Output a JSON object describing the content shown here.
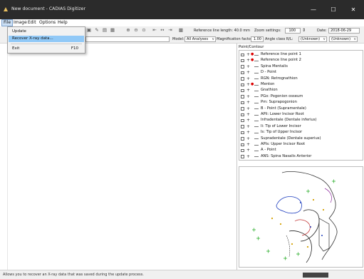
{
  "window": {
    "title": "New document - CADIAS Digitizer",
    "minimize": "—",
    "maximize": "☐",
    "close": "✕"
  },
  "menubar": [
    "File",
    "Image",
    "Edit",
    "Options",
    "Help"
  ],
  "file_menu": {
    "items": [
      {
        "label": "Update",
        "shortcut": ""
      },
      {
        "label": "Recover X-ray data...",
        "shortcut": ""
      },
      {
        "label": "Exit",
        "shortcut": "F10"
      }
    ]
  },
  "toolbar": {
    "ref_length_label": "Reference line length: 40.0 mm",
    "zoom_label": "Zoom settings:",
    "zoom_value": "100",
    "date_label": "Date:",
    "date_value": "2018-06-29",
    "model_label": "Model:",
    "model_value": "All Analyses",
    "mag_label": "Magnification factor:",
    "mag_value": "1.00",
    "angle_label": "Angle class R/L:",
    "angle_r": "(Unknown)",
    "angle_l": "(Unknown)"
  },
  "panel": {
    "title": "Point/Contour",
    "points": [
      {
        "label": "Reference line point 1",
        "red": true
      },
      {
        "label": "Reference line point 2",
        "red": true
      },
      {
        "label": "Spina Mentalis",
        "red": false
      },
      {
        "label": "D - Point",
        "red": false
      },
      {
        "label": "RGN: Retrognathion",
        "red": false
      },
      {
        "label": "Menton",
        "red": true
      },
      {
        "label": "Gnathion",
        "red": false
      },
      {
        "label": "PGo: Pogonion osseum",
        "red": false
      },
      {
        "label": "Pm: Suprapogonion",
        "red": false
      },
      {
        "label": "B - Point  (Supramentale)",
        "red": false
      },
      {
        "label": "APli: Lower Incisor Root",
        "red": false
      },
      {
        "label": "Infradentale (Dentale inferius)",
        "red": false
      },
      {
        "label": "Ii: Tip of Lower Incisor",
        "red": false
      },
      {
        "label": "Is: Tip of Upper Incisor",
        "red": false
      },
      {
        "label": "Supradentale (Dentale superius)",
        "red": false
      },
      {
        "label": "APIs: Upper Incisor Root",
        "red": false
      },
      {
        "label": "A - Point",
        "red": false
      },
      {
        "label": "ANS: Spina Nasalis Anterior",
        "red": false
      }
    ]
  },
  "status": {
    "text": "Allows you to recover an X-ray data that was saved during the update process."
  },
  "colors": {
    "titlebar": "#2b2b2b",
    "highlight": "#91c9f7",
    "marker": "#d00000",
    "cross": "#22aa22"
  }
}
